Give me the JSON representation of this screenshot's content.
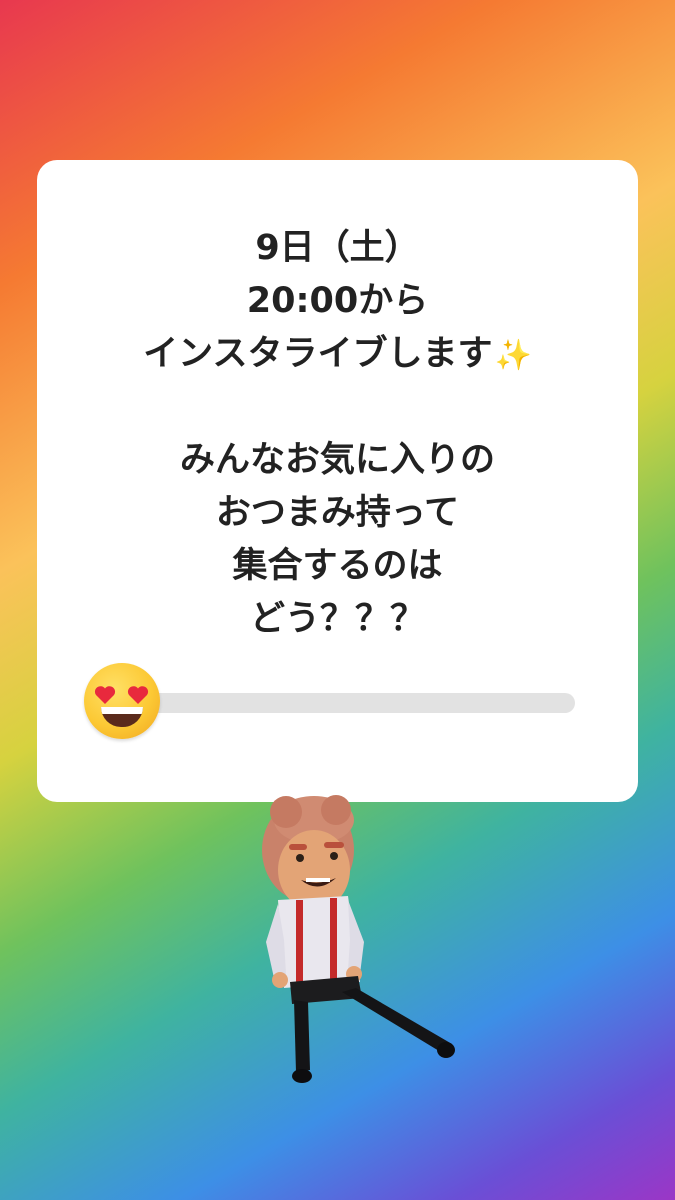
{
  "story": {
    "question_lines": [
      "9日（土）",
      "20:00から",
      "インスタライブします",
      "",
      "みんなお気に入りの",
      "おつまみ持って",
      "集合するのは",
      "どう？？？"
    ],
    "sparkle_emoji": "✨",
    "slider": {
      "emoji": "smiling-face-with-heart-eyes",
      "value": 0
    },
    "sticker": "felt-puppet"
  },
  "colors": {
    "text": "#222222",
    "track": "#e2e2e2",
    "card": "#ffffff"
  }
}
